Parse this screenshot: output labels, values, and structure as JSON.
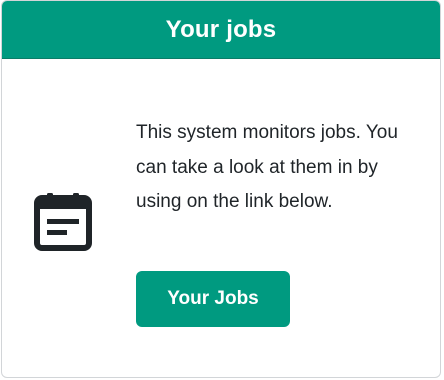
{
  "card": {
    "title": "Your jobs",
    "message": "This system monitors jobs. You can take a look at them in by using on the link below.",
    "icon": "calendar-icon",
    "button_label": "Your Jobs"
  },
  "colors": {
    "accent": "#009a80",
    "text": "#1f2428",
    "icon": "#1f2428"
  }
}
